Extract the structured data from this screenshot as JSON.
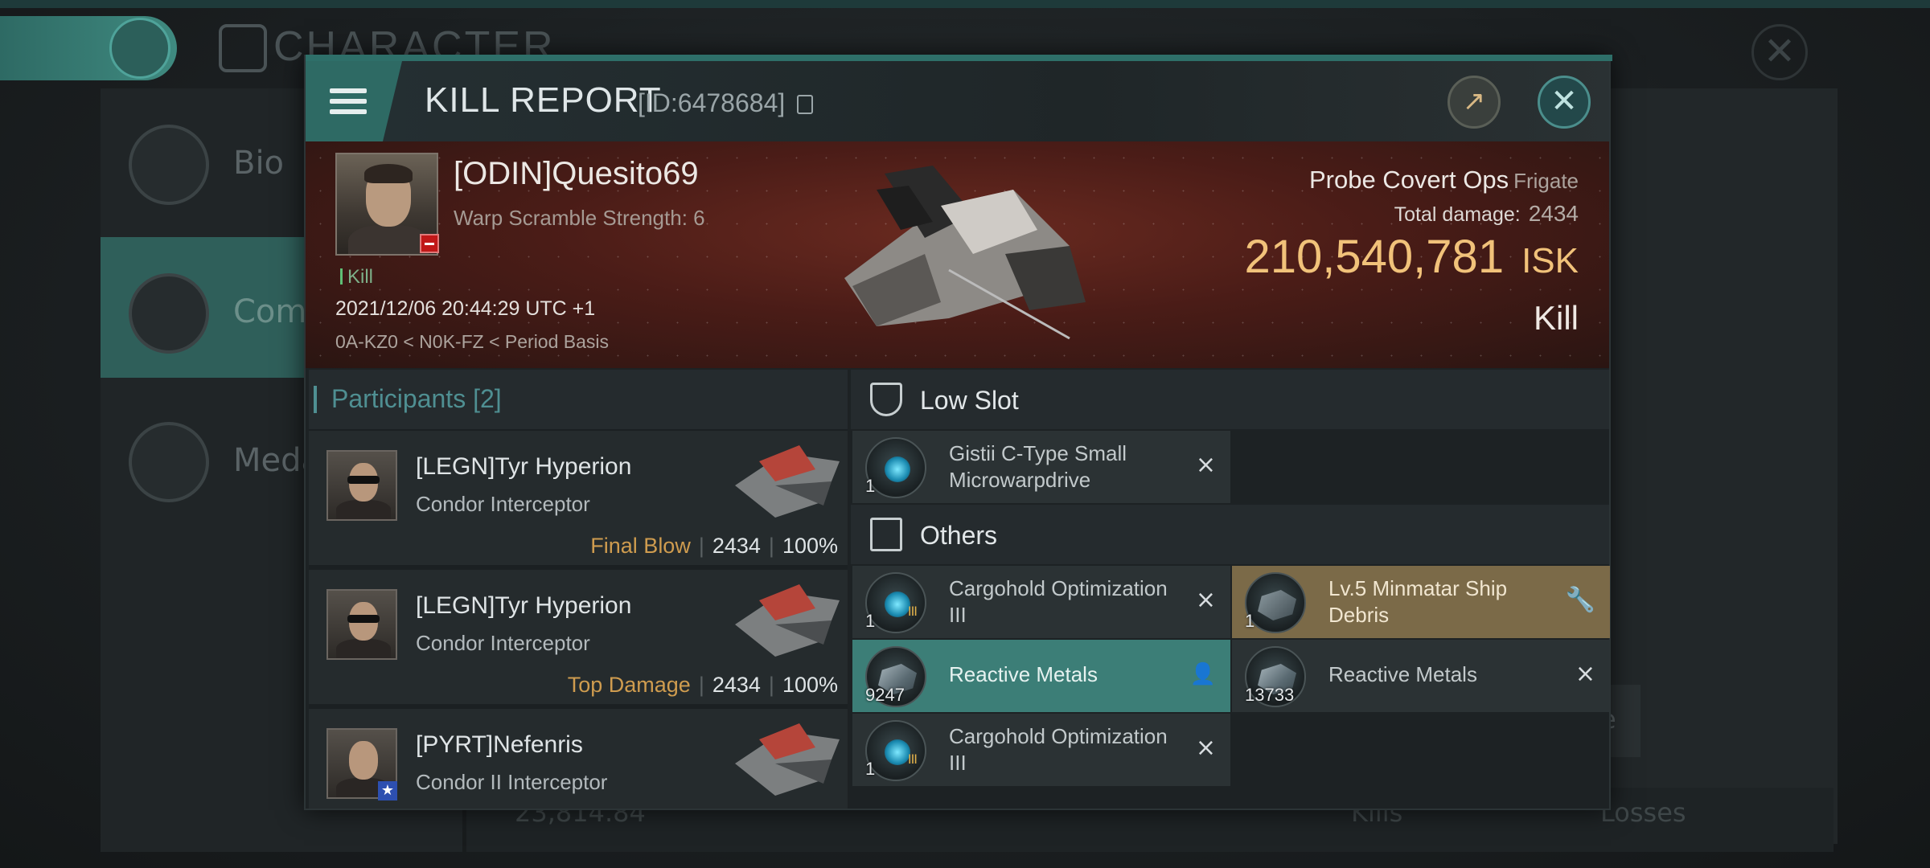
{
  "background": {
    "screen_title": "CHARACTER",
    "sidebar": [
      {
        "label": "Bio"
      },
      {
        "label": "Comb"
      },
      {
        "label": "Meda"
      }
    ],
    "bottom_value": "23,814.84",
    "kills_label": "Kills",
    "losses_label": "Losses",
    "partial_button": "e"
  },
  "modal": {
    "title": "KILL REPORT",
    "report_id": "[ID:6478684]",
    "victim": {
      "name": "[ODIN]Quesito69",
      "warp_scramble": "Warp Scramble Strength: 6",
      "result_tag": "Kill",
      "timestamp": "2021/12/06 20:44:29 UTC +1",
      "location": "0A-KZ0 < N0K-FZ < Period Basis",
      "ship_name": "Probe Covert Ops",
      "ship_class": "Frigate",
      "total_damage_label": "Total damage:",
      "total_damage": "2434",
      "isk_value": "210,540,781",
      "isk_unit": "ISK",
      "outcome": "Kill"
    },
    "participants": {
      "label": "Participants",
      "count": "[2]",
      "rows": [
        {
          "name": "[LEGN]Tyr Hyperion",
          "ship": "Condor Interceptor",
          "tag": "Final Blow",
          "damage": "2434",
          "percent": "100%"
        },
        {
          "name": "[LEGN]Tyr Hyperion",
          "ship": "Condor Interceptor",
          "tag": "Top Damage",
          "damage": "2434",
          "percent": "100%"
        },
        {
          "name": "[PYRT]Nefenris",
          "ship": "Condor II Interceptor",
          "tag": "",
          "damage": "",
          "percent": ""
        }
      ]
    },
    "low_slot": {
      "label": "Low Slot",
      "items": [
        {
          "qty": "1",
          "name": "Gistii C-Type Small Microwarpdrive",
          "action": "×"
        }
      ]
    },
    "others": {
      "label": "Others",
      "items": [
        {
          "qty": "1",
          "name": "Cargohold Optimization III",
          "action": "×",
          "badge": "III"
        },
        {
          "qty": "1",
          "name": "Lv.5 Minmatar Ship Debris",
          "action": "wrench"
        },
        {
          "qty": "9247",
          "name": "Reactive Metals",
          "action": "person"
        },
        {
          "qty": "13733",
          "name": "Reactive Metals",
          "action": "×"
        },
        {
          "qty": "1",
          "name": "Cargohold Optimization III",
          "action": "×",
          "badge": "III"
        }
      ]
    }
  },
  "colors": {
    "accent": "#2e6a64",
    "isk": "#f1c27a",
    "tag": "#cf9c4f",
    "banner": "#4a1c17"
  }
}
